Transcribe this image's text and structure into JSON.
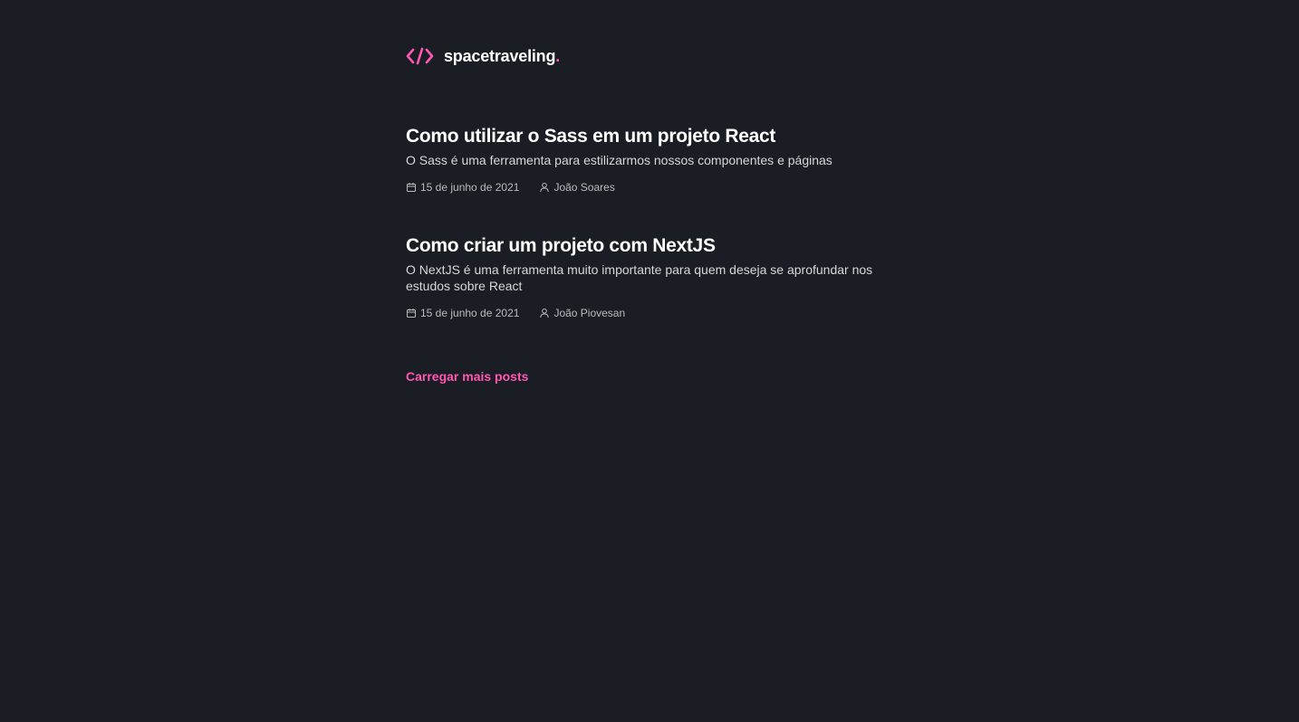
{
  "brand": {
    "name": "spacetraveling",
    "dot": ".",
    "accent_color": "#ff57b2",
    "icon": "code-brackets-icon"
  },
  "posts": [
    {
      "title": "Como utilizar o Sass em um projeto React",
      "subtitle": "O Sass é uma ferramenta para estilizarmos nossos componentes e páginas",
      "date": "15 de junho de 2021",
      "author": "João Soares",
      "date_icon": "calendar-icon",
      "author_icon": "user-icon"
    },
    {
      "title": "Como criar um projeto com NextJS",
      "subtitle": "O NextJS é uma ferramenta muito importante para quem deseja se aprofundar nos estudos sobre React",
      "date": "15 de junho de 2021",
      "author": "João Piovesan",
      "date_icon": "calendar-icon",
      "author_icon": "user-icon"
    }
  ],
  "load_more_label": "Carregar mais posts",
  "colors": {
    "background": "#1a1d23",
    "heading": "#ffffff",
    "body_text": "#d7d7d7",
    "info_text": "#bbbbbb"
  }
}
